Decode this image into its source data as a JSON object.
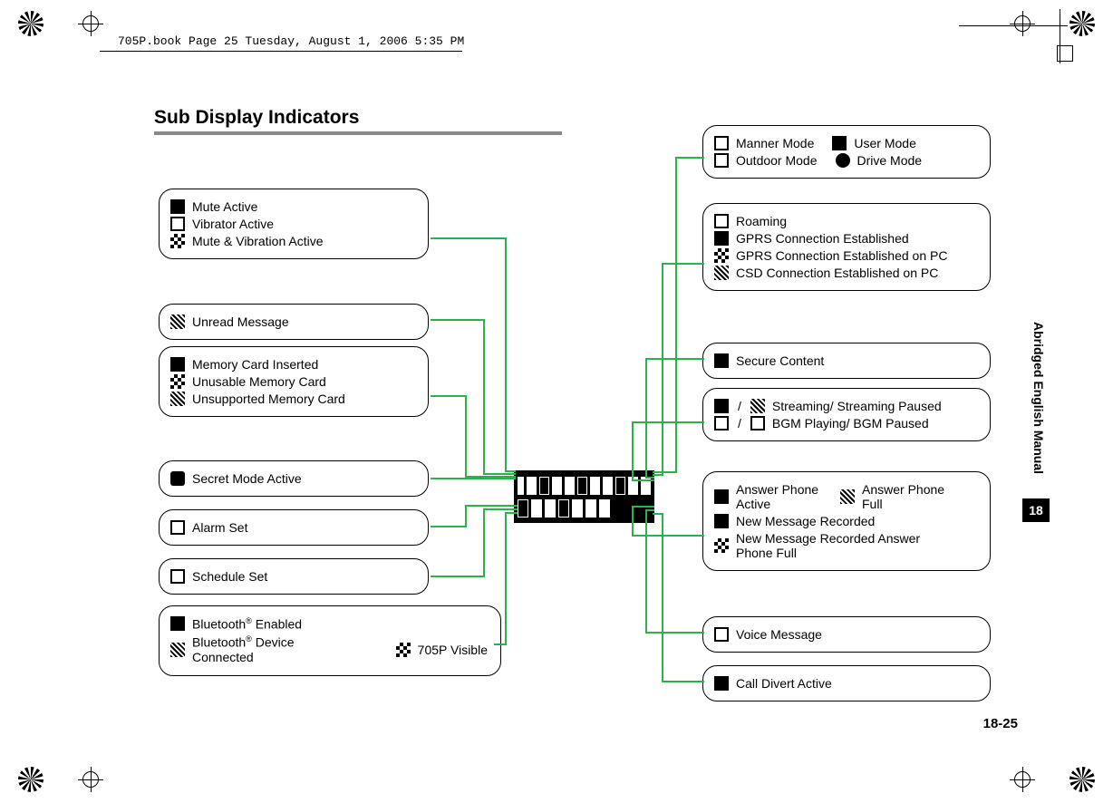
{
  "running_header": "705P.book  Page 25  Tuesday, August 1, 2006  5:35 PM",
  "title": "Sub Display Indicators",
  "side_label": "Abridged English Manual",
  "chapter_number": "18",
  "page_number": "18-25",
  "left": {
    "mute_group": {
      "mute": "Mute Active",
      "vibrator": "Vibrator Active",
      "mute_vib": "Mute & Vibration Active"
    },
    "unread": "Unread Message",
    "memory": {
      "inserted": "Memory Card Inserted",
      "unusable": "Unusable Memory Card",
      "unsupported": "Unsupported Memory Card"
    },
    "secret": "Secret Mode Active",
    "alarm": "Alarm Set",
    "schedule": "Schedule Set",
    "bluetooth": {
      "enabled_pre": "Bluetooth",
      "enabled_suf": " Enabled",
      "connected_pre": "Bluetooth",
      "connected_suf": " Device Connected",
      "visible": "705P Visible",
      "reg_mark": "®"
    }
  },
  "right": {
    "modes": {
      "manner": "Manner Mode",
      "user": "User Mode",
      "outdoor": "Outdoor Mode",
      "drive": "Drive Mode"
    },
    "network": {
      "roaming": "Roaming",
      "gprs": "GPRS Connection Established",
      "gprs_pc": "GPRS Connection Established on PC",
      "csd_pc": "CSD Connection Established on PC"
    },
    "secure": "Secure Content",
    "media": {
      "stream": "Streaming/ Streaming Paused",
      "bgm": "BGM Playing/ BGM Paused"
    },
    "answer": {
      "active": "Answer Phone Active",
      "full": "Answer Phone Full",
      "new": "New Message Recorded",
      "new_full": "New Message Recorded Answer Phone Full"
    },
    "voice": "Voice Message",
    "divert": "Call Divert Active"
  }
}
